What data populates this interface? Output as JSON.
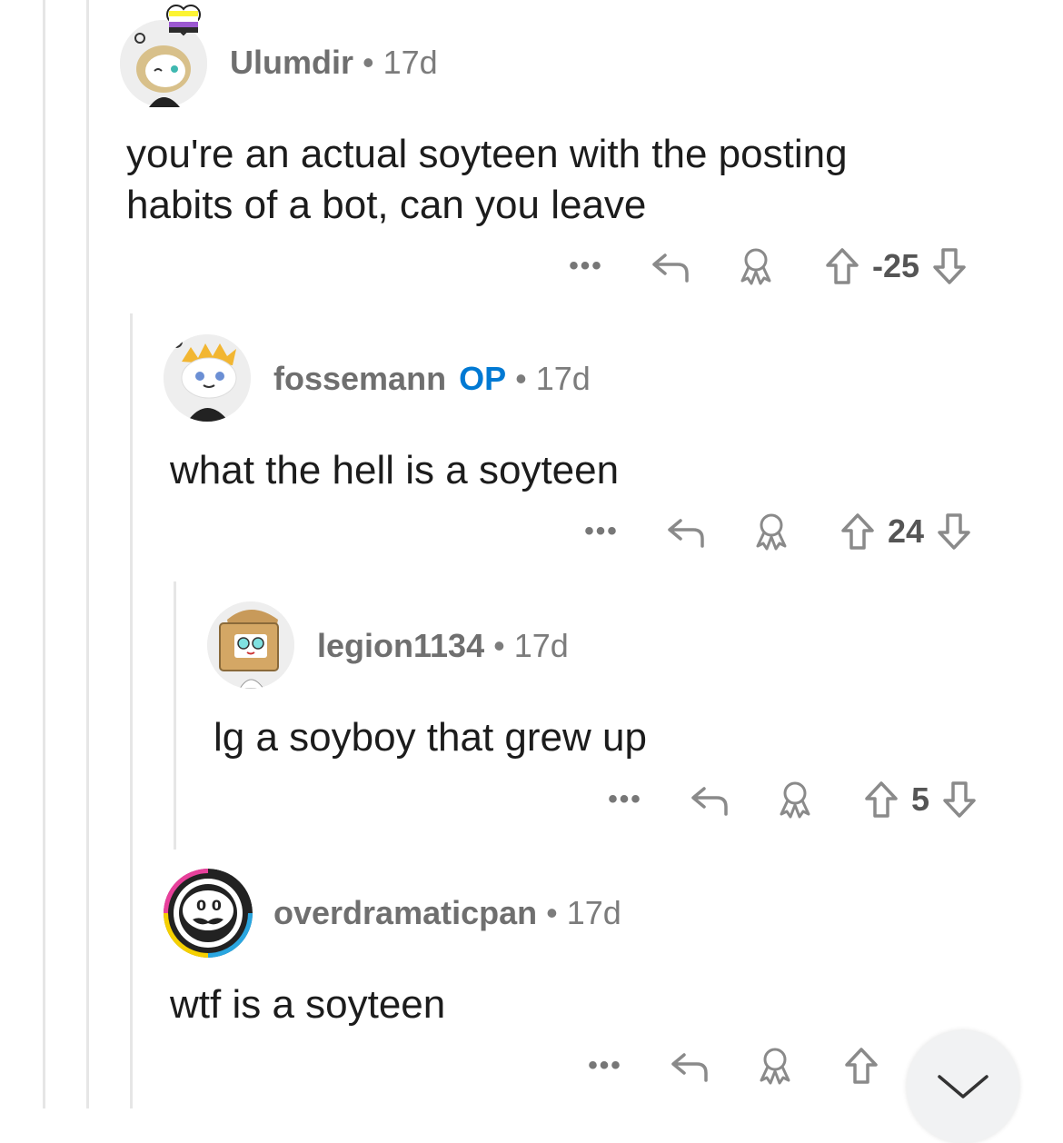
{
  "comments": [
    {
      "username": "Ulumdir",
      "op_badge": "",
      "separator": "•",
      "age": "17d",
      "body_lines": [
        "you're an actual soyteen with the posting",
        "habits of a bot, can you leave"
      ],
      "score": "-25",
      "more": "•••"
    },
    {
      "username": "fossemann",
      "op_badge": "OP",
      "separator": "•",
      "age": "17d",
      "body_lines": [
        "what the hell is a soyteen"
      ],
      "score": "24",
      "more": "•••"
    },
    {
      "username": "legion1134",
      "op_badge": "",
      "separator": "•",
      "age": "17d",
      "body_lines": [
        "lg a soyboy that grew up"
      ],
      "score": "5",
      "more": "•••"
    },
    {
      "username": "overdramaticpan",
      "op_badge": "",
      "separator": "•",
      "age": "17d",
      "body_lines": [
        "wtf is a soyteen"
      ],
      "score": "",
      "more": "•••"
    }
  ],
  "icons": {
    "more": "more-options-icon",
    "reply": "reply-icon",
    "award": "award-icon",
    "upvote": "upvote-icon",
    "downvote": "downvote-icon",
    "scroll": "chevron-down-icon"
  },
  "colors": {
    "op_badge": "#0079d3",
    "meta_text": "#7c7c7c",
    "body_text": "#1c1c1c",
    "thread_line": "#e6e6e6",
    "icon_gray": "#8a8a8a"
  }
}
